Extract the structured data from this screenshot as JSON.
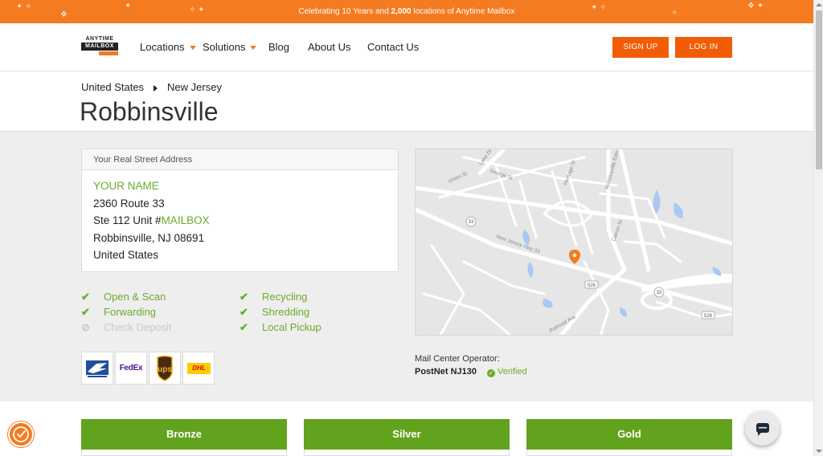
{
  "banner": {
    "text_pre": "Celebrating 10 Years and ",
    "text_bold": "2,000",
    "text_post": " locations of Anytime Mailbox"
  },
  "logo": {
    "line1": "ANYTIME",
    "line2": "MAILBOX"
  },
  "nav": {
    "locations": "Locations",
    "solutions": "Solutions",
    "blog": "Blog",
    "about": "About Us",
    "contact": "Contact Us",
    "signup": "SIGN UP",
    "login": "LOG IN"
  },
  "breadcrumb": {
    "country": "United States",
    "state": "New Jersey"
  },
  "page_title": "Robbinsville",
  "address_card": {
    "heading": "Your Real Street Address",
    "name": "YOUR NAME",
    "street": "2360 Route 33",
    "suite_prefix": "Ste 112 Unit #",
    "suite_var": "MAILBOX",
    "city": "Robbinsville, NJ 08691",
    "country": "United States"
  },
  "features": {
    "open_scan": "Open & Scan",
    "forwarding": "Forwarding",
    "check_deposit": "Check Deposit",
    "recycling": "Recycling",
    "shredding": "Shredding",
    "local_pickup": "Local Pickup"
  },
  "carriers": {
    "fedex": "FedEx",
    "ups": "ups",
    "dhl": "DHL"
  },
  "map": {
    "streets": [
      "Union St",
      "George St",
      "Lake Dr",
      "Heritage St",
      "Robbinsville Edin",
      "Carron St",
      "New Jersey Hwy 33",
      "Railroad Ave"
    ],
    "shields": [
      "33",
      "526",
      "33",
      "526"
    ]
  },
  "operator": {
    "label": "Mail Center Operator:",
    "name": "PostNet NJ130",
    "status": "Verified"
  },
  "plans": {
    "bronze": "Bronze",
    "silver": "Silver",
    "gold": "Gold"
  },
  "colors": {
    "brand_orange": "#f47b20",
    "button_orange": "#f25c05",
    "green": "#6cab2c",
    "plan_green": "#62a31e"
  }
}
